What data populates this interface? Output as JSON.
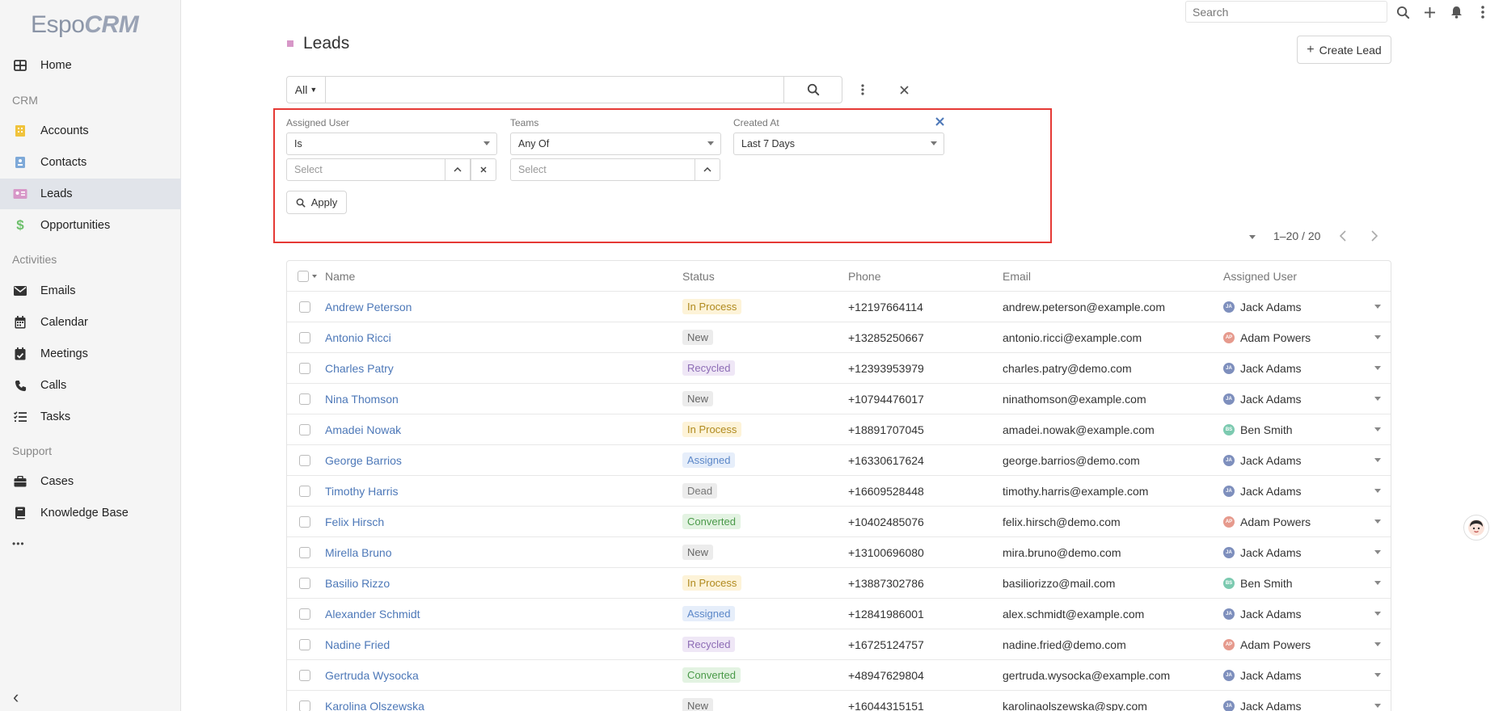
{
  "app": {
    "logo_text_1": "Espo",
    "logo_text_2": "CRM"
  },
  "sidebar": {
    "items": [
      {
        "label": "Home",
        "icon": "grid-icon"
      },
      {
        "label": "Accounts",
        "icon": "building-icon"
      },
      {
        "label": "Contacts",
        "icon": "contact-card-icon"
      },
      {
        "label": "Leads",
        "icon": "id-card-icon",
        "active": true
      },
      {
        "label": "Opportunities",
        "icon": "dollar-icon"
      },
      {
        "label": "Emails",
        "icon": "envelope-icon"
      },
      {
        "label": "Calendar",
        "icon": "calendar-icon"
      },
      {
        "label": "Meetings",
        "icon": "calendar-check-icon"
      },
      {
        "label": "Calls",
        "icon": "phone-icon"
      },
      {
        "label": "Tasks",
        "icon": "tasks-icon"
      },
      {
        "label": "Cases",
        "icon": "briefcase-icon"
      },
      {
        "label": "Knowledge Base",
        "icon": "book-icon"
      }
    ],
    "groups": {
      "crm": "CRM",
      "activities": "Activities",
      "support": "Support"
    },
    "more": "•••",
    "collapse": "‹"
  },
  "topbar": {
    "search_placeholder": "Search"
  },
  "header": {
    "title": "Leads",
    "create_label": "Create Lead"
  },
  "search": {
    "scope": "All",
    "value": ""
  },
  "filters": {
    "assigned_user": {
      "label": "Assigned User",
      "operator": "Is",
      "placeholder": "Select"
    },
    "teams": {
      "label": "Teams",
      "operator": "Any Of",
      "placeholder": "Select"
    },
    "created_at": {
      "label": "Created At",
      "value": "Last 7 Days"
    },
    "apply_label": "Apply"
  },
  "pagination": {
    "text": "1–20 / 20"
  },
  "table": {
    "headers": {
      "name": "Name",
      "status": "Status",
      "phone": "Phone",
      "email": "Email",
      "assigned": "Assigned User"
    },
    "status_colors": {
      "In Process": {
        "bg": "#fdf3d8",
        "fg": "#b08a1e"
      },
      "New": {
        "bg": "#ececec",
        "fg": "#666666"
      },
      "Recycled": {
        "bg": "#efe7f6",
        "fg": "#8d6cb5"
      },
      "Assigned": {
        "bg": "#e6eefa",
        "fg": "#5b87c8"
      },
      "Dead": {
        "bg": "#ececec",
        "fg": "#777777"
      },
      "Converted": {
        "bg": "#e3f3e2",
        "fg": "#4a9a49"
      }
    },
    "user_colors": {
      "Jack Adams": "#7e8fbd",
      "Adam Powers": "#e69a8d",
      "Ben Smith": "#7ccab0"
    },
    "user_initials": {
      "Jack Adams": "JA",
      "Adam Powers": "AP",
      "Ben Smith": "BS"
    },
    "rows": [
      {
        "name": "Andrew Peterson",
        "status": "In Process",
        "phone": "+12197664114",
        "email": "andrew.peterson@example.com",
        "assigned": "Jack Adams"
      },
      {
        "name": "Antonio Ricci",
        "status": "New",
        "phone": "+13285250667",
        "email": "antonio.ricci@example.com",
        "assigned": "Adam Powers"
      },
      {
        "name": "Charles Patry",
        "status": "Recycled",
        "phone": "+12393953979",
        "email": "charles.patry@demo.com",
        "assigned": "Jack Adams"
      },
      {
        "name": "Nina Thomson",
        "status": "New",
        "phone": "+10794476017",
        "email": "ninathomson@example.com",
        "assigned": "Jack Adams"
      },
      {
        "name": "Amadei Nowak",
        "status": "In Process",
        "phone": "+18891707045",
        "email": "amadei.nowak@example.com",
        "assigned": "Ben Smith"
      },
      {
        "name": "George Barrios",
        "status": "Assigned",
        "phone": "+16330617624",
        "email": "george.barrios@demo.com",
        "assigned": "Jack Adams"
      },
      {
        "name": "Timothy Harris",
        "status": "Dead",
        "phone": "+16609528448",
        "email": "timothy.harris@example.com",
        "assigned": "Jack Adams"
      },
      {
        "name": "Felix Hirsch",
        "status": "Converted",
        "phone": "+10402485076",
        "email": "felix.hirsch@demo.com",
        "assigned": "Adam Powers"
      },
      {
        "name": "Mirella Bruno",
        "status": "New",
        "phone": "+13100696080",
        "email": "mira.bruno@demo.com",
        "assigned": "Jack Adams"
      },
      {
        "name": "Basilio Rizzo",
        "status": "In Process",
        "phone": "+13887302786",
        "email": "basiliorizzo@mail.com",
        "assigned": "Ben Smith"
      },
      {
        "name": "Alexander Schmidt",
        "status": "Assigned",
        "phone": "+12841986001",
        "email": "alex.schmidt@example.com",
        "assigned": "Jack Adams"
      },
      {
        "name": "Nadine Fried",
        "status": "Recycled",
        "phone": "+16725124757",
        "email": "nadine.fried@demo.com",
        "assigned": "Adam Powers"
      },
      {
        "name": "Gertruda Wysocka",
        "status": "Converted",
        "phone": "+48947629804",
        "email": "gertruda.wysocka@example.com",
        "assigned": "Jack Adams"
      },
      {
        "name": "Karolina Olszewska",
        "status": "New",
        "phone": "+16044315151",
        "email": "karolinaolszewska@spy.com",
        "assigned": "Jack Adams"
      }
    ]
  }
}
